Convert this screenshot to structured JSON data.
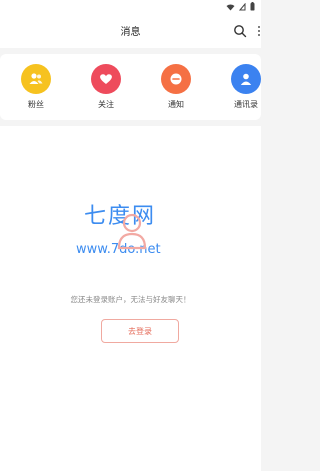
{
  "header": {
    "title": "消息"
  },
  "shortcuts": [
    {
      "label": "粉丝",
      "icon": "fans-icon",
      "color": "#f6c21f"
    },
    {
      "label": "关注",
      "icon": "heart-icon",
      "color": "#ee4b5c"
    },
    {
      "label": "通知",
      "icon": "notice-icon",
      "color": "#f57044"
    },
    {
      "label": "通讯录",
      "icon": "contacts-icon",
      "color": "#3b82f0"
    }
  ],
  "empty_state": {
    "message": "您还未登录账户，无法与好友聊天！",
    "login_button": "去登录"
  },
  "watermark": {
    "title": "七度网",
    "subtitle": "www.7do.net"
  },
  "colors": {
    "accent": "#e46a58",
    "watermark": "#3c8cf0"
  }
}
